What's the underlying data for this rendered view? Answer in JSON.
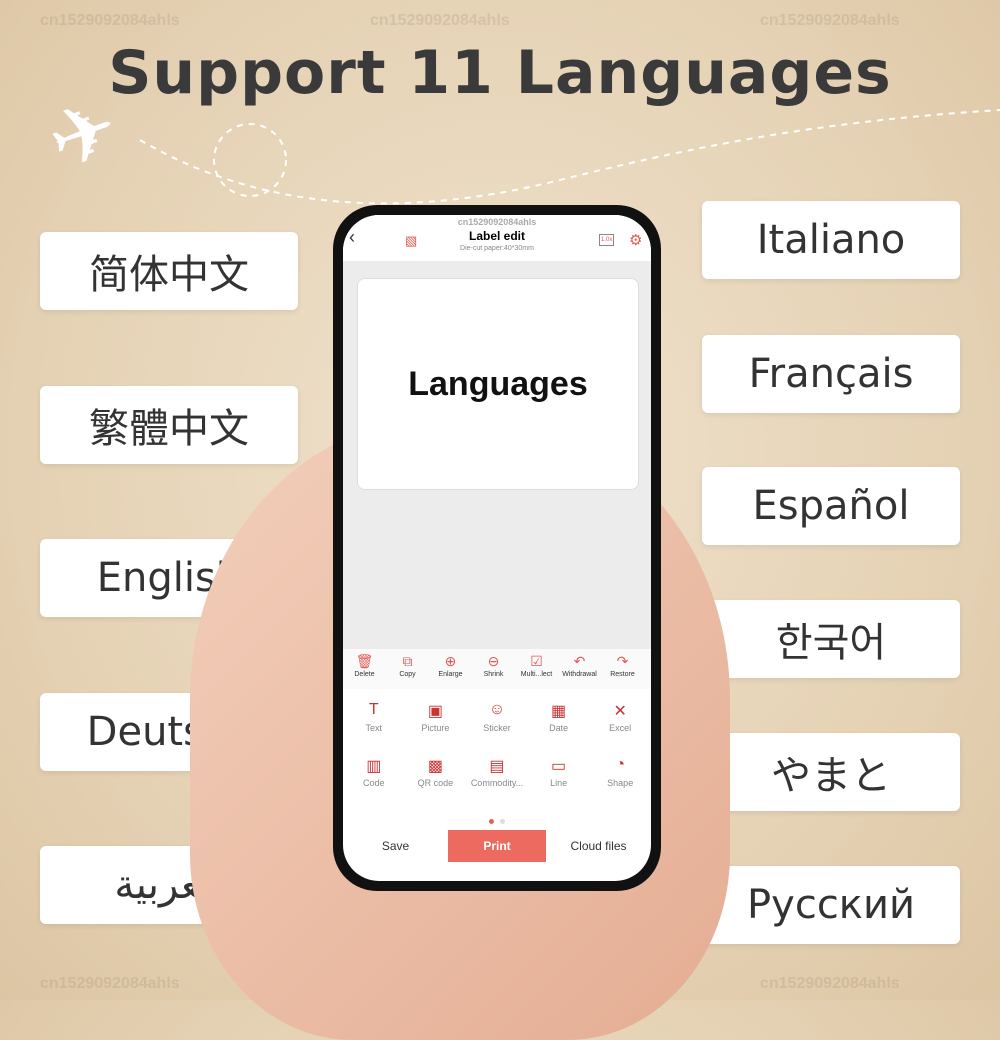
{
  "title": "Support 11 Languages",
  "watermark": "cn1529092084ahls",
  "languages_left": [
    "简体中文",
    "繁體中文",
    "English",
    "Deutsch",
    "العربية"
  ],
  "languages_right": [
    "Italiano",
    "Français",
    "Español",
    "한국어",
    "やまと",
    "Русский"
  ],
  "app": {
    "watermark": "cn1529092084ahls",
    "title": "Label edit",
    "subtitle": "Die-cut paper:40*30mm",
    "zoom_level": "1.0x",
    "label_text": "Languages",
    "toolbar": [
      {
        "icon": "trash-icon",
        "glyph": "🗑",
        "label": "Delete"
      },
      {
        "icon": "copy-icon",
        "glyph": "⧉",
        "label": "Copy"
      },
      {
        "icon": "plus-circle-icon",
        "glyph": "⊕",
        "label": "Enlarge"
      },
      {
        "icon": "minus-circle-icon",
        "glyph": "⊖",
        "label": "Shrink"
      },
      {
        "icon": "multi-select-icon",
        "glyph": "☑",
        "label": "Multi...lect"
      },
      {
        "icon": "undo-icon",
        "glyph": "↶",
        "label": "Withdrawal"
      },
      {
        "icon": "redo-icon",
        "glyph": "↷",
        "label": "Restore"
      }
    ],
    "tools": [
      {
        "icon": "text-icon",
        "glyph": "T",
        "label": "Text"
      },
      {
        "icon": "picture-icon",
        "glyph": "▣",
        "label": "Picture"
      },
      {
        "icon": "sticker-icon",
        "glyph": "☺",
        "label": "Sticker"
      },
      {
        "icon": "date-icon",
        "glyph": "▦",
        "label": "Date"
      },
      {
        "icon": "excel-icon",
        "glyph": "✕",
        "label": "Excel"
      },
      {
        "icon": "barcode-icon",
        "glyph": "▥",
        "label": "Code"
      },
      {
        "icon": "qr-code-icon",
        "glyph": "▩",
        "label": "QR code"
      },
      {
        "icon": "commodity-icon",
        "glyph": "▤",
        "label": "Commodity..."
      },
      {
        "icon": "line-icon",
        "glyph": "▭",
        "label": "Line"
      },
      {
        "icon": "shape-icon",
        "glyph": "◔",
        "label": "Shape"
      }
    ],
    "save": "Save",
    "print": "Print",
    "cloud": "Cloud files",
    "accent": "#ec6a60"
  }
}
